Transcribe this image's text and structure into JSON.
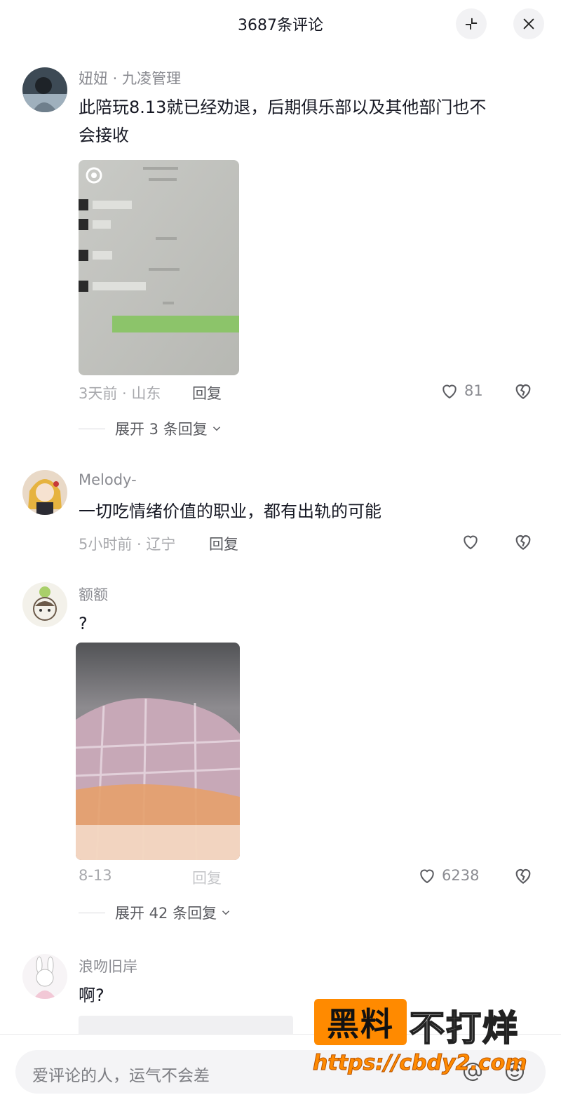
{
  "header": {
    "title": "3687条评论"
  },
  "comments": [
    {
      "username": "妞妞 · 九凌管理",
      "text_line1": "此陪玩8.13就已经劝退，后期俱乐部以及其他部门也不",
      "text_line2": "会接收",
      "time": "3天前 · 山东",
      "reply": "回复",
      "likes": "81",
      "expand": "展开 3 条回复"
    },
    {
      "username": "Melody-",
      "text": "一切吃情绪价值的职业，都有出轨的可能",
      "time": "5小时前 · 辽宁",
      "reply": "回复",
      "likes": ""
    },
    {
      "username": "额额",
      "text": "?",
      "time": "8-13",
      "reply": "回复",
      "likes": "6238",
      "expand": "展开 42 条回复"
    },
    {
      "username": "浪吻旧岸",
      "text": "啊?"
    }
  ],
  "bottom": {
    "placeholder": "爱评论的人，运气不会差"
  },
  "watermark": {
    "box_text": "黑料",
    "text": "不打烊",
    "url": "https://cbdy2.com"
  },
  "icons": [
    "collapse-icon",
    "close-icon",
    "heart-icon",
    "broken-heart-icon",
    "chevron-down-icon",
    "at-icon",
    "emoji-icon"
  ]
}
